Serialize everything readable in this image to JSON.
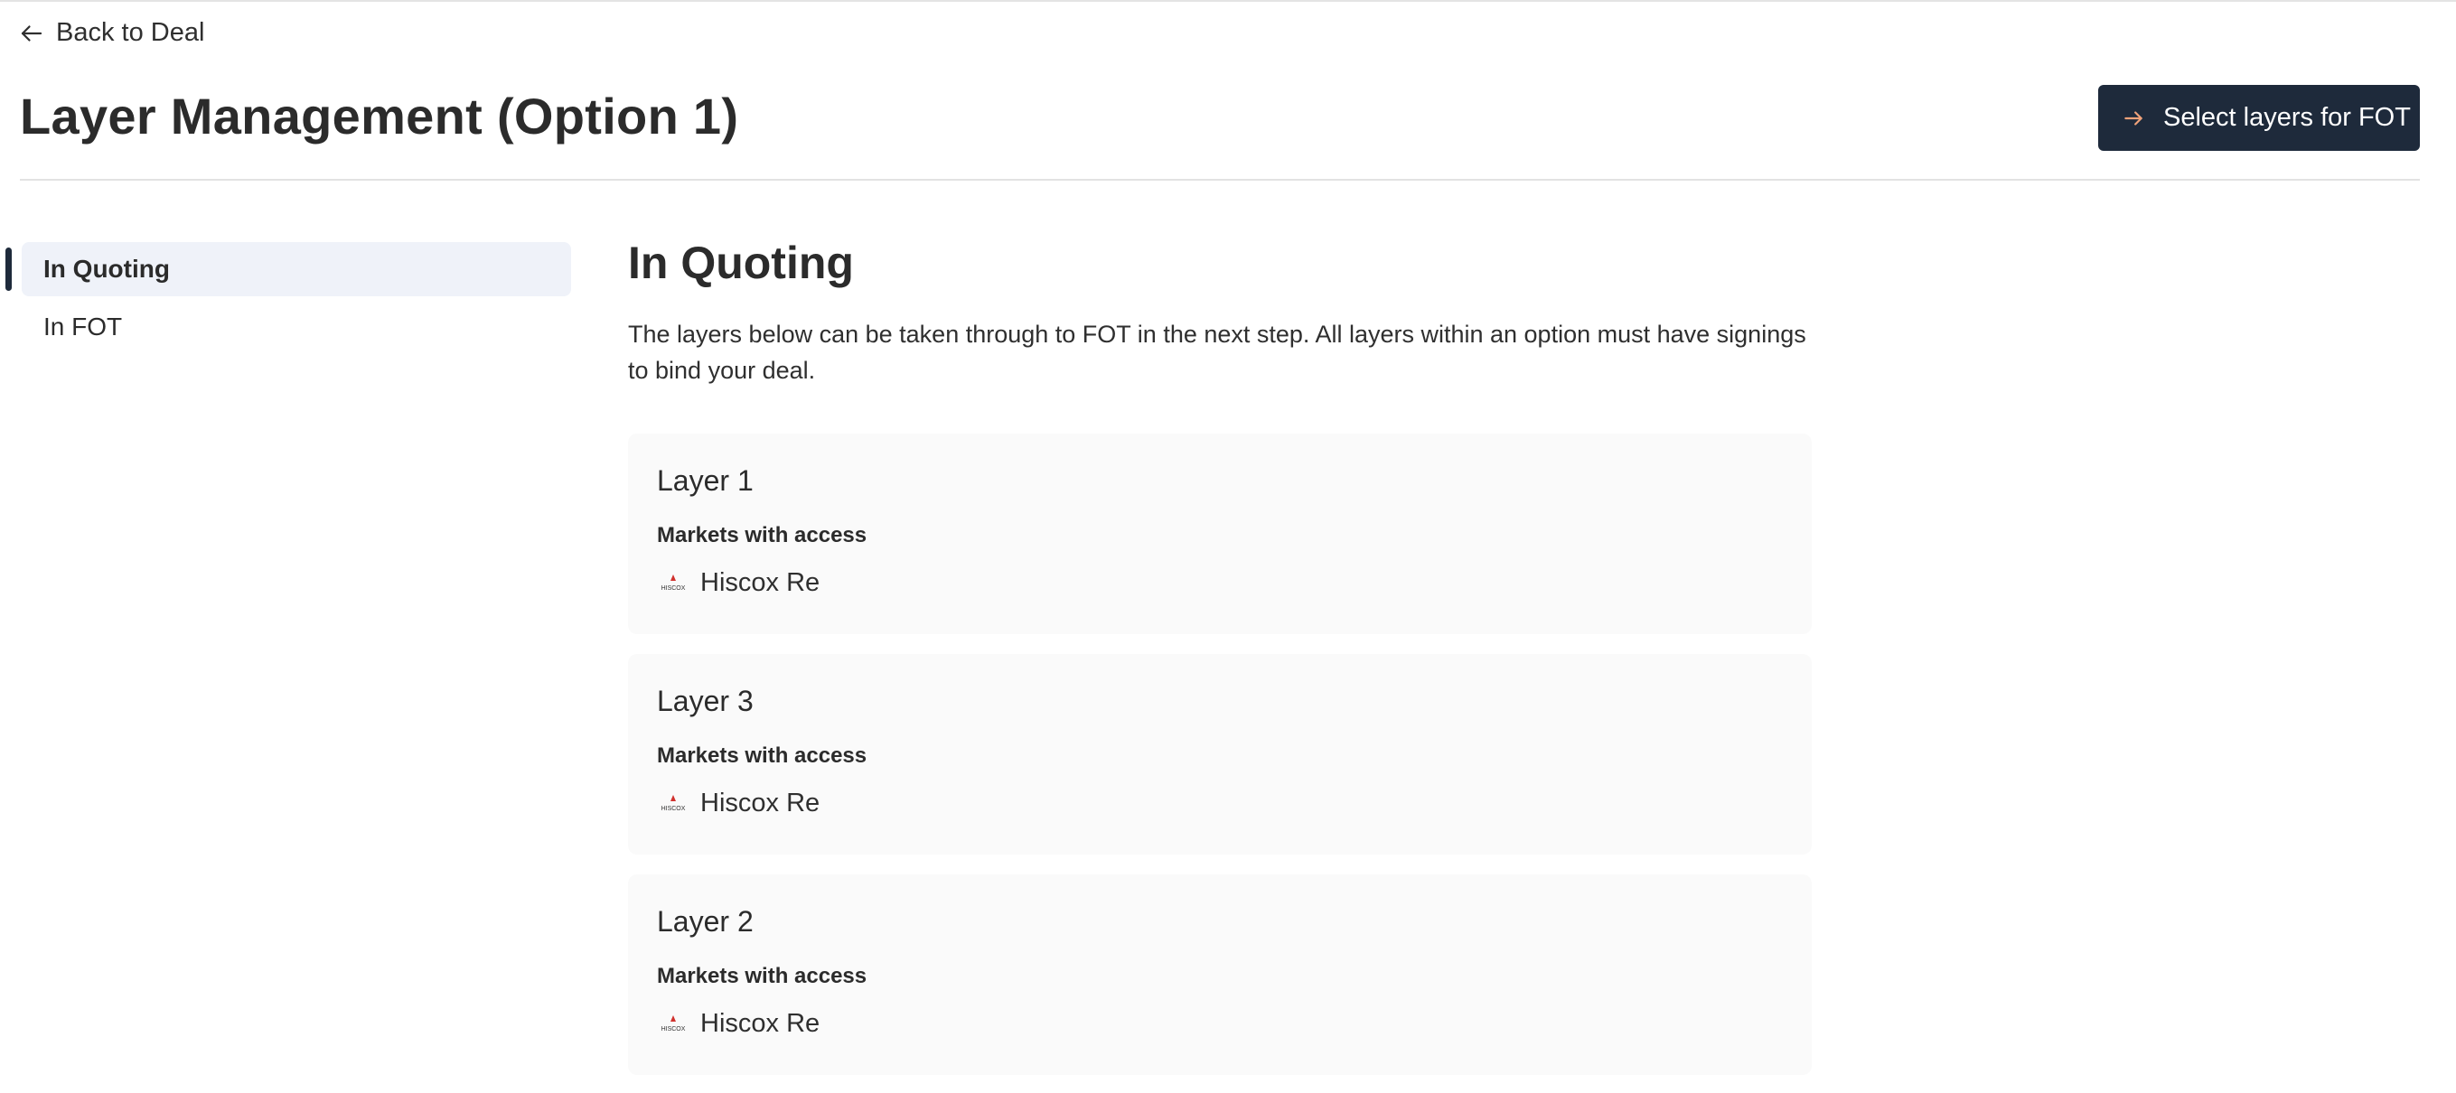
{
  "header": {
    "back_label": "Back to Deal",
    "title": "Layer Management (Option 1)",
    "primary_button_label": "Select layers for FOT"
  },
  "sidebar": {
    "items": [
      {
        "label": "In Quoting",
        "active": true
      },
      {
        "label": "In FOT",
        "active": false
      }
    ]
  },
  "main": {
    "section_title": "In Quoting",
    "description": "The layers below can be taken through to FOT in the next step. All layers within an option must have signings to bind your deal.",
    "layers": [
      {
        "name": "Layer 1",
        "markets_label": "Markets with access",
        "markets": [
          {
            "logo_text": "HISCOX",
            "name": "Hiscox Re"
          }
        ]
      },
      {
        "name": "Layer 3",
        "markets_label": "Markets with access",
        "markets": [
          {
            "logo_text": "HISCOX",
            "name": "Hiscox Re"
          }
        ]
      },
      {
        "name": "Layer 2",
        "markets_label": "Markets with access",
        "markets": [
          {
            "logo_text": "HISCOX",
            "name": "Hiscox Re"
          }
        ]
      }
    ]
  },
  "colors": {
    "primary": "#1e2a3b",
    "button_arrow": "#f0a27a",
    "sidebar_active_bg": "#eff2f9",
    "card_bg": "#fafafa",
    "logo_red": "#d0312d"
  },
  "icons": {
    "back": "arrow-left-icon",
    "primary_button": "arrow-right-icon",
    "market_logo": "hiscox-logo-icon"
  }
}
